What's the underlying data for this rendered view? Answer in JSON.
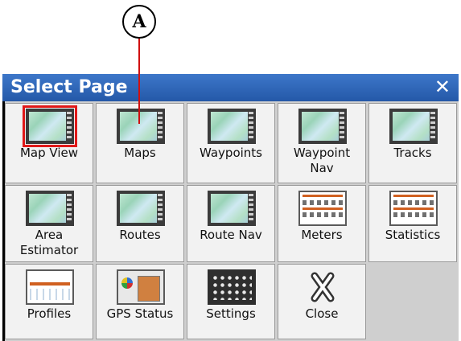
{
  "callout": {
    "letter": "A"
  },
  "dialog": {
    "title": "Select Page",
    "close_glyph": "✕"
  },
  "tiles": [
    {
      "label": "Map View",
      "icon": "map-view-icon",
      "selected": true
    },
    {
      "label": "Maps",
      "icon": "maps-icon"
    },
    {
      "label": "Waypoints",
      "icon": "waypoints-icon"
    },
    {
      "label": "Waypoint\nNav",
      "icon": "waypoint-nav-icon"
    },
    {
      "label": "Tracks",
      "icon": "tracks-icon"
    },
    {
      "label": "Area\nEstimator",
      "icon": "area-estimator-icon"
    },
    {
      "label": "Routes",
      "icon": "routes-icon"
    },
    {
      "label": "Route Nav",
      "icon": "route-nav-icon"
    },
    {
      "label": "Meters",
      "icon": "meters-icon"
    },
    {
      "label": "Statistics",
      "icon": "statistics-icon"
    },
    {
      "label": "Profiles",
      "icon": "profiles-icon"
    },
    {
      "label": "GPS Status",
      "icon": "gps-status-icon"
    },
    {
      "label": "Settings",
      "icon": "settings-icon"
    },
    {
      "label": "Close",
      "icon": "close-icon"
    }
  ],
  "colors": {
    "titlebar": "#2f66b8",
    "selection": "#e01818",
    "callout_line": "#d01010"
  }
}
